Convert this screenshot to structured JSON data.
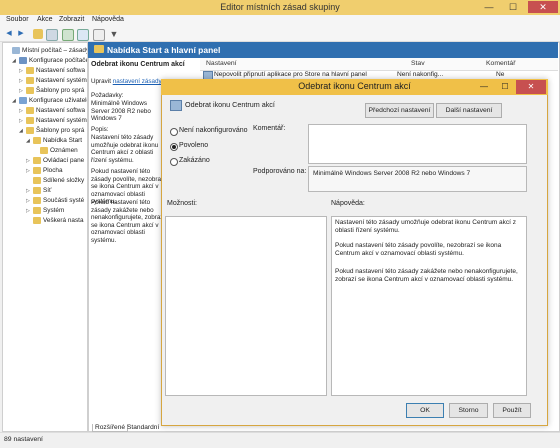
{
  "window": {
    "title": "Editor místních zásad skupiny",
    "controls": {
      "minimize": "—",
      "maximize": "☐",
      "close": "✕"
    }
  },
  "menu": [
    "Soubor",
    "Akce",
    "Zobrazit",
    "Nápověda"
  ],
  "toolbar_icons": [
    "back-icon",
    "forward-icon",
    "up-folder-icon",
    "show-tree-icon",
    "export-icon",
    "help-icon",
    "properties-icon",
    "filter-icon"
  ],
  "tree": [
    {
      "label": "Místní počítač – zásady",
      "level": 0,
      "exp": "",
      "icon": "doc"
    },
    {
      "label": "Konfigurace počítače",
      "level": 1,
      "exp": "◢",
      "icon": "computer"
    },
    {
      "label": "Nastavení softwa",
      "level": 2,
      "exp": "▷",
      "icon": "folder"
    },
    {
      "label": "Nastavení systém",
      "level": 2,
      "exp": "▷",
      "icon": "folder"
    },
    {
      "label": "Šablony pro sprá",
      "level": 2,
      "exp": "▷",
      "icon": "folder"
    },
    {
      "label": "Konfigurace uživatele",
      "level": 1,
      "exp": "◢",
      "icon": "user"
    },
    {
      "label": "Nastavení softwa",
      "level": 2,
      "exp": "▷",
      "icon": "folder"
    },
    {
      "label": "Nastavení systém",
      "level": 2,
      "exp": "▷",
      "icon": "folder"
    },
    {
      "label": "Šablony pro sprá",
      "level": 2,
      "exp": "◢",
      "icon": "folder"
    },
    {
      "label": "Nabídka Start",
      "level": 3,
      "exp": "◢",
      "icon": "folder"
    },
    {
      "label": "Oznámen",
      "level": 4,
      "exp": "",
      "icon": "folder"
    },
    {
      "label": "Ovládací pane",
      "level": 3,
      "exp": "▷",
      "icon": "folder"
    },
    {
      "label": "Plocha",
      "level": 3,
      "exp": "▷",
      "icon": "folder"
    },
    {
      "label": "Sdílené složky",
      "level": 3,
      "exp": "",
      "icon": "folder"
    },
    {
      "label": "Síť",
      "level": 3,
      "exp": "▷",
      "icon": "folder"
    },
    {
      "label": "Součásti systé",
      "level": 3,
      "exp": "▷",
      "icon": "folder"
    },
    {
      "label": "Systém",
      "level": 3,
      "exp": "▷",
      "icon": "folder"
    },
    {
      "label": "Veškerá nasta",
      "level": 3,
      "exp": "",
      "icon": "folder"
    }
  ],
  "pane": {
    "header_title": "Nabídka Start a hlavní panel",
    "columns": {
      "name": "Nastavení",
      "state": "Stav",
      "comment": "Komentář"
    },
    "row": {
      "name": "Nepovolit připnutí aplikace pro Store na hlavní panel",
      "state": "Není nakonfig...",
      "comment": "Ne"
    },
    "desc_title": "Odebrat ikonu Centrum akcí",
    "desc_edit_prefix": "Upravit ",
    "desc_edit_link": "nastavení zásady",
    "desc_req_label": "Požadavky:",
    "desc_req": "Minimálně Windows Server 2008 R2 nebo Windows 7",
    "desc_desc_label": "Popis:",
    "desc_desc": "Nastavení této zásady umožňuje odebrat ikonu Centrum akcí z oblasti řízení systému.",
    "desc_p2": "Pokud nastavení této zásady povolíte, nezobrazí se ikona Centrum akcí v oznamovací oblasti systému.",
    "desc_p3": "Pokud nastavení této zásady zakážete nebo nenakonfigurujete, zobrazí se ikona Centrum akcí v oznamovací oblasti systému.",
    "tabs": {
      "extended": "Rozšířené",
      "standard": "Standardní"
    }
  },
  "status": "89 nastavení",
  "dialog": {
    "title": "Odebrat ikonu Centrum akcí",
    "policy_name": "Odebrat ikonu Centrum akcí",
    "btn_prev": "Předchozí nastavení",
    "btn_next": "Další nastavení",
    "radio_not_configured": "Není nakonfigurováno",
    "radio_enabled": "Povoleno",
    "radio_disabled": "Zakázáno",
    "selected": "enabled",
    "comment_label": "Komentář:",
    "comment_value": "",
    "supported_label": "Podporováno na:",
    "supported_value": "Minimálně Windows Server 2008 R2 nebo Windows 7",
    "options_label": "Možnosti:",
    "help_label": "Nápověda:",
    "help_p1": "Nastavení této zásady umožňuje odebrat ikonu Centrum akcí z oblasti řízení systému.",
    "help_p2": "Pokud nastavení této zásady povolíte, nezobrazí se ikona Centrum akcí v oznamovací oblasti systému.",
    "help_p3": "Pokud nastavení této zásady zakážete nebo nenakonfigurujete, zobrazí se ikona Centrum akcí v oznamovací oblasti systému.",
    "btn_ok": "OK",
    "btn_cancel": "Storno",
    "btn_apply": "Použít"
  }
}
